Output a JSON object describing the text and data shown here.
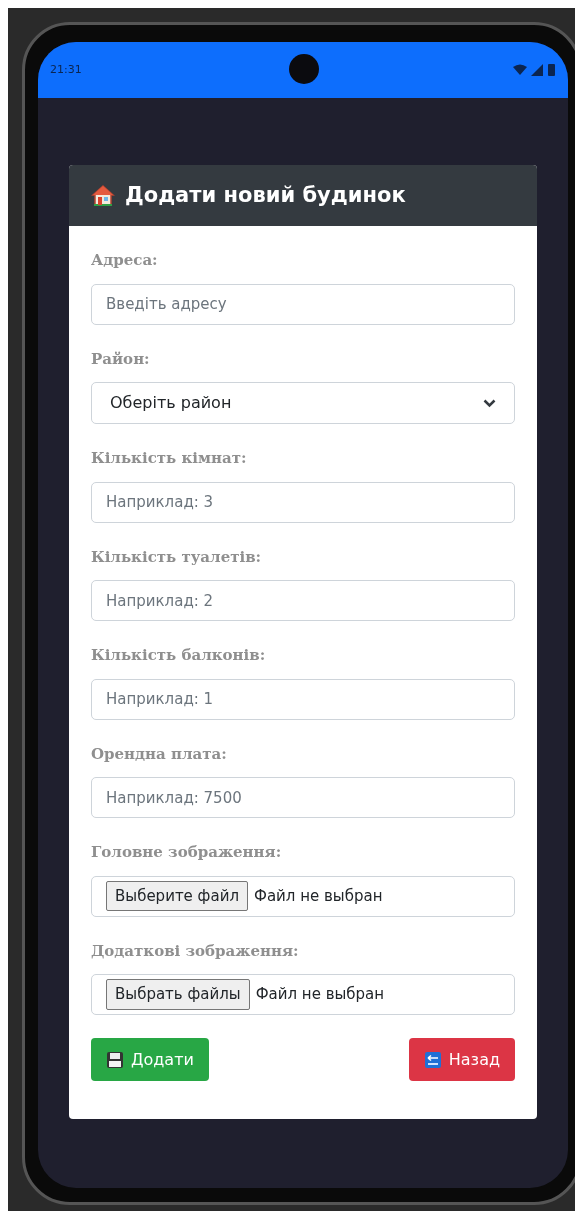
{
  "status_bar": {
    "time": "21:31"
  },
  "card": {
    "title": "Додати новий будинок",
    "fields": [
      {
        "kind": "text",
        "label": "Адреса:",
        "placeholder": "Введіть адресу"
      },
      {
        "kind": "select",
        "label": "Район:",
        "value": "Оберіть район"
      },
      {
        "kind": "text",
        "label": "Кількість кімнат:",
        "placeholder": "Наприклад: 3"
      },
      {
        "kind": "text",
        "label": "Кількість туалетів:",
        "placeholder": "Наприклад: 2"
      },
      {
        "kind": "text",
        "label": "Кількість балконів:",
        "placeholder": "Наприклад: 1"
      },
      {
        "kind": "text",
        "label": "Орендна плата:",
        "placeholder": "Наприклад: 7500"
      },
      {
        "kind": "file",
        "label": "Головне зображення:",
        "button": "Выберите файл",
        "status": "Файл не выбран"
      },
      {
        "kind": "file",
        "label": "Додаткові зображення:",
        "button": "Выбрать файлы",
        "status": "Файл не выбран"
      }
    ],
    "buttons": [
      {
        "kind": "save",
        "label": "Додати"
      },
      {
        "kind": "back",
        "label": "Назад"
      }
    ]
  }
}
